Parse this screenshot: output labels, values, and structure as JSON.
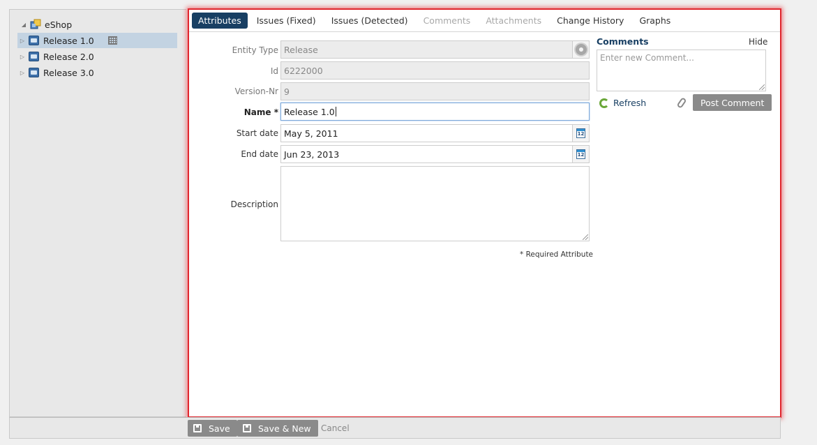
{
  "tree": {
    "root": {
      "label": "eShop"
    },
    "items": [
      {
        "label": "Release 1.0"
      },
      {
        "label": "Release 2.0"
      },
      {
        "label": "Release 3.0"
      }
    ]
  },
  "tabs": [
    {
      "label": "Attributes",
      "state": "active"
    },
    {
      "label": "Issues (Fixed)",
      "state": "normal"
    },
    {
      "label": "Issues (Detected)",
      "state": "normal"
    },
    {
      "label": "Comments",
      "state": "disabled"
    },
    {
      "label": "Attachments",
      "state": "disabled"
    },
    {
      "label": "Change History",
      "state": "normal"
    },
    {
      "label": "Graphs",
      "state": "normal"
    }
  ],
  "form": {
    "entity_type": {
      "label": "Entity Type",
      "value": "Release"
    },
    "id": {
      "label": "Id",
      "value": "6222000"
    },
    "version_nr": {
      "label": "Version-Nr",
      "value": "9"
    },
    "name": {
      "label": "Name",
      "required_mark": "*",
      "value": "Release 1.0"
    },
    "start_date": {
      "label": "Start date",
      "value": "May 5, 2011"
    },
    "end_date": {
      "label": "End date",
      "value": "Jun 23, 2013"
    },
    "description": {
      "label": "Description",
      "value": ""
    },
    "required_note": "* Required Attribute",
    "calendar_day": "12"
  },
  "comments": {
    "title": "Comments",
    "hide_label": "Hide",
    "placeholder": "Enter new Comment...",
    "refresh_label": "Refresh",
    "post_label": "Post Comment"
  },
  "footer": {
    "save_label": "Save",
    "save_new_label": "Save & New",
    "cancel_label": "Cancel"
  },
  "colors": {
    "active_tab": "#183f63",
    "highlight_border": "#e0262e",
    "tree_selection": "#c3d3e2",
    "button_gray": "#8a8a8a"
  }
}
